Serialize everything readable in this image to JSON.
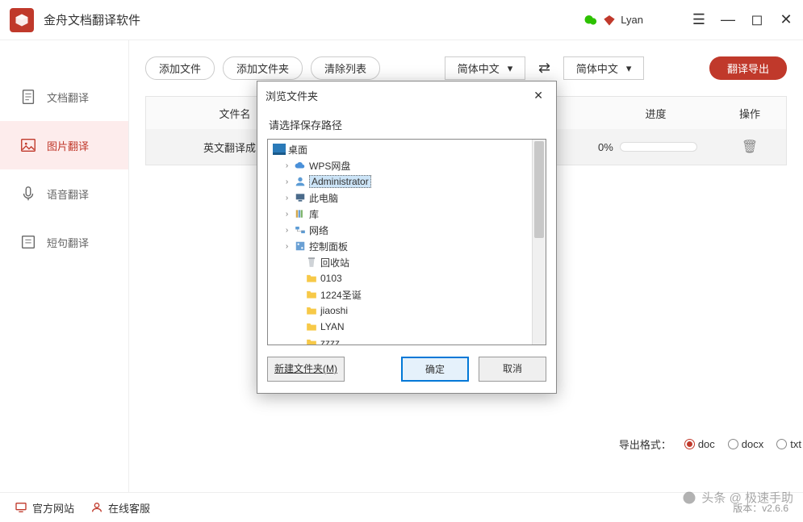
{
  "app": {
    "title": "金舟文档翻译软件",
    "user": "Lyan"
  },
  "sidebar": {
    "items": [
      {
        "label": "文档翻译"
      },
      {
        "label": "图片翻译"
      },
      {
        "label": "语音翻译"
      },
      {
        "label": "短句翻译"
      }
    ]
  },
  "toolbar": {
    "add_file": "添加文件",
    "add_folder": "添加文件夹",
    "clear_list": "清除列表",
    "lang_from": "简体中文",
    "lang_to": "简体中文",
    "export": "翻译导出"
  },
  "table": {
    "col_filename": "文件名",
    "col_progress": "进度",
    "col_action": "操作",
    "row_name": "英文翻译成中",
    "row_pct": "0%"
  },
  "export": {
    "label": "导出格式：",
    "opt1": "doc",
    "opt2": "docx",
    "opt3": "txt"
  },
  "bottom": {
    "site": "官方网站",
    "support": "在线客服",
    "version": "版本：v2.6.6"
  },
  "watermark": "头条 @ 极速手助",
  "dialog": {
    "title": "浏览文件夹",
    "subtitle": "请选择保存路径",
    "new_folder": "新建文件夹(M)",
    "ok": "确定",
    "cancel": "取消",
    "tree": {
      "root": "桌面",
      "items": [
        {
          "label": "WPS网盘",
          "icon": "cloud"
        },
        {
          "label": "Administrator",
          "icon": "user",
          "selected": true
        },
        {
          "label": "此电脑",
          "icon": "pc"
        },
        {
          "label": "库",
          "icon": "lib"
        },
        {
          "label": "网络",
          "icon": "net"
        },
        {
          "label": "控制面板",
          "icon": "ctrl"
        },
        {
          "label": "回收站",
          "icon": "bin",
          "sub": true
        },
        {
          "label": "0103",
          "icon": "folder",
          "sub": true
        },
        {
          "label": "1224圣诞",
          "icon": "folder",
          "sub": true
        },
        {
          "label": "jiaoshi",
          "icon": "folder",
          "sub": true
        },
        {
          "label": "LYAN",
          "icon": "folder",
          "sub": true
        },
        {
          "label": "zzzz",
          "icon": "folder",
          "sub": true
        }
      ]
    }
  }
}
